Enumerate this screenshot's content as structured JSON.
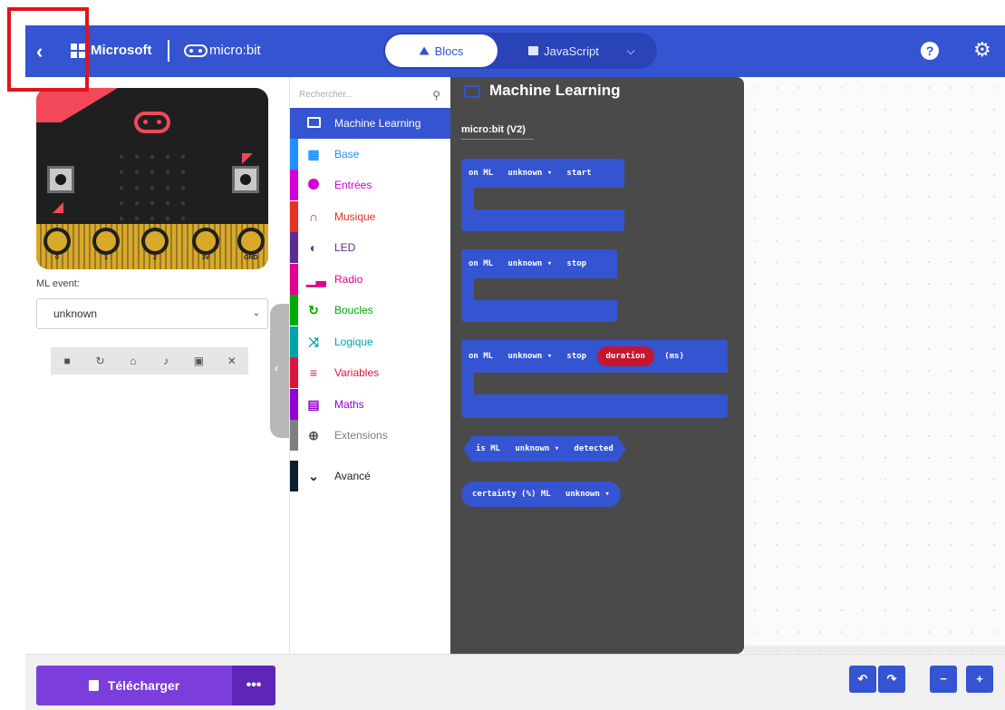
{
  "header": {
    "back_icon": "chevron-left-icon",
    "brand": "Microsoft",
    "product": "micro:bit",
    "tabs": [
      {
        "label": "Blocs",
        "active": true
      },
      {
        "label": "JavaScript",
        "active": false
      }
    ],
    "help_glyph": "?",
    "gear_glyph": "⚙"
  },
  "simulator": {
    "pin_labels": [
      "0",
      "1",
      "2",
      "3V",
      "GND"
    ],
    "ml_event_label": "ML event:",
    "ml_event_value": "unknown",
    "toolbar_icons": [
      "■",
      "↻",
      "⌂",
      "♪",
      "▣",
      "✕"
    ]
  },
  "toolbox": {
    "search_placeholder": "Rechercher...",
    "categories": [
      {
        "label": "Machine Learning",
        "color": "#3454d1",
        "icon": "monitor-icon"
      },
      {
        "label": "Base",
        "color": "#1e90ff",
        "icon": "grid-icon"
      },
      {
        "label": "Entrées",
        "color": "#d400d4",
        "icon": "target-icon"
      },
      {
        "label": "Musique",
        "color": "#e63022",
        "icon": "headphones-icon"
      },
      {
        "label": "LED",
        "color": "#5c2d91",
        "icon": "toggle-icon"
      },
      {
        "label": "Radio",
        "color": "#e3008c",
        "icon": "signal-icon"
      },
      {
        "label": "Boucles",
        "color": "#00aa00",
        "icon": "loop-icon"
      },
      {
        "label": "Logique",
        "color": "#00a4a6",
        "icon": "shuffle-icon"
      },
      {
        "label": "Variables",
        "color": "#dc143c",
        "icon": "list-icon"
      },
      {
        "label": "Maths",
        "color": "#9400d3",
        "icon": "calculator-icon"
      },
      {
        "label": "Extensions",
        "color": "#7f7f7f",
        "icon": "plus-circle-icon"
      }
    ],
    "advanced_label": "Avancé"
  },
  "flyout": {
    "title": "Machine Learning",
    "subtitle": "micro:bit (V2)",
    "blocks": {
      "start": {
        "on": "on ML",
        "event": "unknown ▾",
        "action": "start"
      },
      "stop": {
        "on": "on ML",
        "event": "unknown ▾",
        "action": "stop"
      },
      "stop_duration": {
        "on": "on ML",
        "event": "unknown ▾",
        "action": "stop",
        "param": "duration",
        "unit": "(ms)"
      },
      "detected": {
        "pre": "is ML",
        "event": "unknown ▾",
        "post": "detected"
      },
      "certainty": {
        "pre": "certainty (%) ML",
        "event": "unknown ▾"
      }
    }
  },
  "bottom": {
    "download_label": "Télécharger",
    "more_label": "•••",
    "undo_glyph": "↶",
    "redo_glyph": "↷",
    "zoom_out_glyph": "−",
    "zoom_in_glyph": "+"
  },
  "colors": {
    "header_blue": "#3454d1",
    "download_purple": "#7b3ddb",
    "flyout_bg": "#4a4a4a",
    "highlight_red": "#e2141b"
  }
}
